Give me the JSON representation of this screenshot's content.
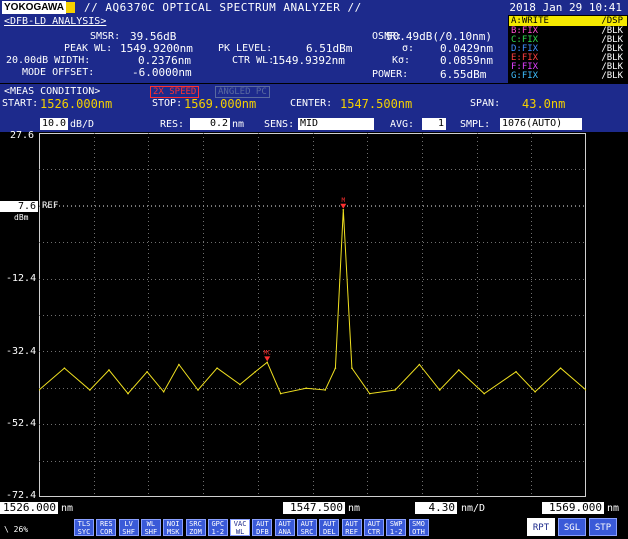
{
  "title_bar": {
    "brand": "YOKOGAWA",
    "app_title": "// AQ6370C OPTICAL SPECTRUM ANALYZER //",
    "datetime": "2018 Jan 29 10:41"
  },
  "analysis": {
    "heading": "<DFB-LD ANALYSIS>",
    "smsr_label": "SMSR:",
    "smsr_value": "39.56dB",
    "peak_wl_label": "PEAK WL:",
    "peak_wl_value": "1549.9200nm",
    "width_label": "20.00dB WIDTH:",
    "width_value": "0.2376nm",
    "mode_offset_label": "MODE OFFSET:",
    "mode_offset_value": "-6.0000nm",
    "pk_level_label": "PK LEVEL:",
    "pk_level_value": "6.51dBm",
    "ctr_wl_label": "CTR WL:",
    "ctr_wl_value": "1549.9392nm",
    "osnr_label": "OSNR:",
    "osnr_value": "50.49dB(/0.10nm)",
    "sigma_label": "σ:",
    "sigma_value": "0.0429nm",
    "k_sigma_label": "Kσ:",
    "k_sigma_value": "0.0859nm",
    "power_label": "POWER:",
    "power_value": "6.55dBm"
  },
  "traces": [
    {
      "name": "A:WRITE",
      "mode": "/DSP",
      "active": true
    },
    {
      "name": "B:FIX",
      "mode": "/BLK",
      "color": "#ff4fd0"
    },
    {
      "name": "C:FIX",
      "mode": "/BLK",
      "color": "#2fd84f"
    },
    {
      "name": "D:FIX",
      "mode": "/BLK",
      "color": "#3f8fff"
    },
    {
      "name": "E:FIX",
      "mode": "/BLK",
      "color": "#ff3f3f"
    },
    {
      "name": "F:FIX",
      "mode": "/BLK",
      "color": "#e040ff"
    },
    {
      "name": "G:FIX",
      "mode": "/BLK",
      "color": "#3fbfff"
    }
  ],
  "condition": {
    "heading": "<MEAS CONDITION>",
    "speed_badge": "2X SPEED",
    "angled_badge": "ANGLED PC",
    "start_label": "START:",
    "start_value": "1526.000nm",
    "stop_label": "STOP:",
    "stop_value": "1569.000nm",
    "center_label": "CENTER:",
    "center_value": "1547.500nm",
    "span_label": "SPAN:",
    "span_value": "43.0nm"
  },
  "params": {
    "ref_scale": "10.0",
    "ref_scale_unit": "dB/D",
    "res_label": "RES:",
    "res_value": "0.2",
    "res_unit": "nm",
    "sens_label": "SENS:",
    "sens_value": "MID",
    "avg_label": "AVG:",
    "avg_value": "1",
    "smpl_label": "SMPL:",
    "smpl_value": "1076(AUTO)"
  },
  "y_axis": {
    "ticks": [
      "27.6",
      "7.6",
      "-12.4",
      "-32.4",
      "-52.4",
      "-72.4"
    ],
    "ref_label": "REF",
    "unit": "dBm"
  },
  "markers": {
    "main": "M",
    "secondary": "MC"
  },
  "bottom": {
    "start": "1526.000",
    "start_unit": "nm",
    "center": "1547.500",
    "center_unit": "nm",
    "per_div": "4.30",
    "per_div_unit": "nm/D",
    "stop": "1569.000",
    "stop_unit": "nm",
    "status": "\\ 26%"
  },
  "softkeys": [
    {
      "l1": "TLS",
      "l2": "SYC"
    },
    {
      "l1": "RES",
      "l2": "COR"
    },
    {
      "l1": "LV",
      "l2": "SHF"
    },
    {
      "l1": "WL",
      "l2": "SHF"
    },
    {
      "l1": "NOI",
      "l2": "MSK"
    },
    {
      "l1": "SRC",
      "l2": "ZOM"
    },
    {
      "l1": "GPC",
      "l2": "1-2"
    },
    {
      "l1": "VAC",
      "l2": "WL",
      "on": true
    },
    {
      "l1": "AUT",
      "l2": "DFB"
    },
    {
      "l1": "AUT",
      "l2": "ANA"
    },
    {
      "l1": "AUT",
      "l2": "SRC"
    },
    {
      "l1": "AUT",
      "l2": "DEL"
    },
    {
      "l1": "AUT",
      "l2": "REF"
    },
    {
      "l1": "AUT",
      "l2": "CTR"
    },
    {
      "l1": "SWP",
      "l2": "1-2"
    },
    {
      "l1": "SMO",
      "l2": "OTH"
    }
  ],
  "sweep_buttons": [
    "RPT",
    "SGL",
    "STP"
  ],
  "chart_data": {
    "type": "line",
    "x_unit": "nm",
    "y_unit": "dBm",
    "xlim": [
      1526.0,
      1569.0
    ],
    "ylim": [
      -72.4,
      27.6
    ],
    "trace_color": "#f0e020",
    "grid": true,
    "x": [
      1526.0,
      1528.0,
      1530.0,
      1531.5,
      1533.0,
      1534.5,
      1535.8,
      1537.0,
      1538.5,
      1540.0,
      1541.8,
      1543.0,
      1543.94,
      1545.0,
      1547.0,
      1548.5,
      1549.3,
      1549.92,
      1550.6,
      1552.0,
      1554.0,
      1555.9,
      1557.5,
      1559.0,
      1561.0,
      1563.5,
      1565.0,
      1567.0,
      1569.0
    ],
    "y": [
      -43.0,
      -37.0,
      -43.0,
      -37.5,
      -44.0,
      -38.0,
      -43.5,
      -36.0,
      -43.0,
      -37.0,
      -41.5,
      -38.0,
      -35.4,
      -44.0,
      -42.5,
      -43.0,
      -37.0,
      6.51,
      -37.0,
      -44.0,
      -43.0,
      -36.0,
      -43.0,
      -37.5,
      -44.0,
      -38.0,
      -43.5,
      -37.0,
      -43.0
    ]
  }
}
